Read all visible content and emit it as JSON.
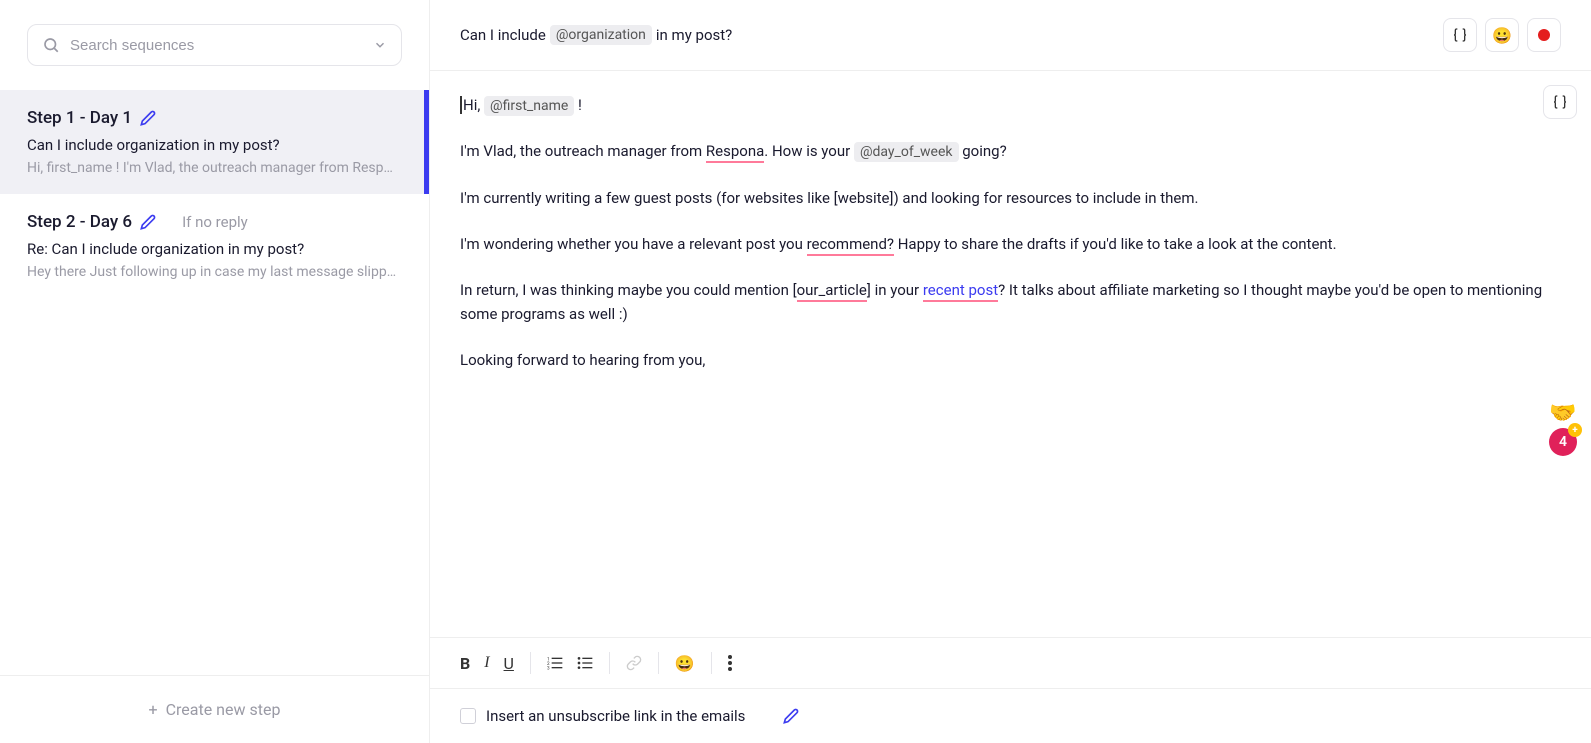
{
  "search": {
    "placeholder": "Search sequences"
  },
  "steps": [
    {
      "title": "Step 1 - Day 1",
      "condition": "",
      "subject": "Can I include organization in my post?",
      "preview": "Hi, first_name ! I'm Vlad, the outreach manager from Respon...",
      "active": true
    },
    {
      "title": "Step 2 - Day 6",
      "condition": "If no reply",
      "subject": "Re: Can I include organization in my post?",
      "preview": "Hey there Just following up in case my last message slipped ...",
      "active": false
    }
  ],
  "create_step": "Create new step",
  "subject": {
    "pre": "Can I include",
    "var": "@organization",
    "post": "in my post?"
  },
  "body": {
    "greeting_pre": "Hi,",
    "greeting_var": "@first_name",
    "greeting_post": "!",
    "intro_pre": "I'm Vlad, the outreach manager from ",
    "intro_link": "Respona",
    "intro_mid": ". How is your",
    "intro_var": "@day_of_week",
    "intro_post": "going?",
    "p1": "I'm currently writing a few guest posts (for websites like [website]) and looking for resources to include in them.",
    "p2_pre": "I'm wondering whether you have a relevant post you ",
    "p2_link": "recommend?",
    "p2_post": " Happy to share the drafts if you'd like to take a look at the content.",
    "p3_pre": "In return, I was thinking maybe you could mention [",
    "p3_link1": "our_article",
    "p3_mid1": "] in your ",
    "p3_link2": "recent post",
    "p3_post": "? It talks about affiliate marketing so I thought maybe you'd be open to mentioning some programs as well :)",
    "closing": "Looking forward to hearing from you,"
  },
  "reactions": {
    "emoji": "🤝",
    "count": "4"
  },
  "footer": {
    "unsubscribe": "Insert an unsubscribe link in the emails"
  }
}
